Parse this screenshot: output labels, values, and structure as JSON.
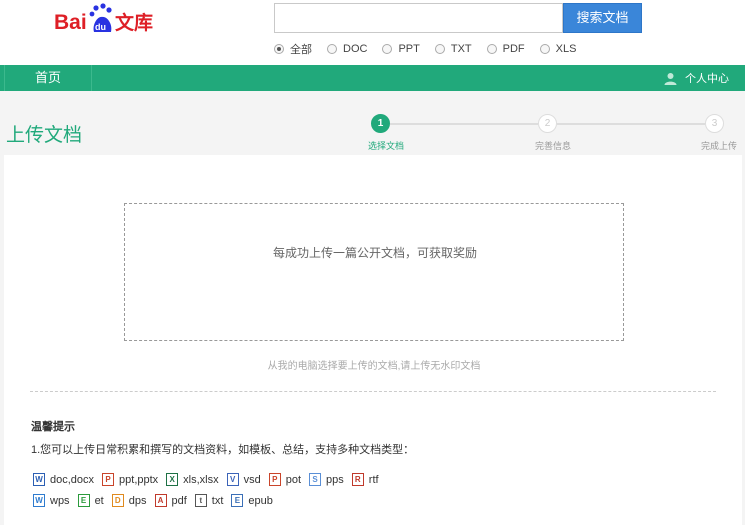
{
  "search": {
    "placeholder": "",
    "button": "搜索文档"
  },
  "filters": [
    {
      "label": "全部",
      "checked": true
    },
    {
      "label": "DOC",
      "checked": false
    },
    {
      "label": "PPT",
      "checked": false
    },
    {
      "label": "TXT",
      "checked": false
    },
    {
      "label": "PDF",
      "checked": false
    },
    {
      "label": "XLS",
      "checked": false
    }
  ],
  "nav": {
    "home": "首页",
    "user_center": "个人中心"
  },
  "page": {
    "title": "上传文档"
  },
  "steps": [
    {
      "number": "1",
      "label": "选择文档",
      "active": true
    },
    {
      "number": "2",
      "label": "完善信息",
      "active": false
    },
    {
      "number": "3",
      "label": "完成上传",
      "active": false
    }
  ],
  "upload": {
    "prompt": "每成功上传一篇公开文档，可获取奖励",
    "hint": "从我的电脑选择要上传的文档,请上传无水印文档"
  },
  "tips": {
    "title": "温馨提示",
    "desc": "1.您可以上传日常积累和撰写的文档资料，如模板、总结，支持多种文档类型："
  },
  "filetypes_row1": [
    {
      "label": "doc,docx",
      "icon": "word-icon",
      "glyph": "W",
      "color": "#2b5fb4"
    },
    {
      "label": "ppt,pptx",
      "icon": "powerpoint-icon",
      "glyph": "P",
      "color": "#c9442a"
    },
    {
      "label": "xls,xlsx",
      "icon": "excel-icon",
      "glyph": "X",
      "color": "#1e7145"
    },
    {
      "label": "vsd",
      "icon": "visio-icon",
      "glyph": "V",
      "color": "#3b63b8"
    },
    {
      "label": "pot",
      "icon": "template-icon",
      "glyph": "P",
      "color": "#c9442a"
    },
    {
      "label": "pps",
      "icon": "slideshow-icon",
      "glyph": "S",
      "color": "#5a8fd6"
    },
    {
      "label": "rtf",
      "icon": "rtf-icon",
      "glyph": "R",
      "color": "#c0392b"
    }
  ],
  "filetypes_row2": [
    {
      "label": "wps",
      "icon": "wps-icon",
      "glyph": "W",
      "color": "#2e7bcf"
    },
    {
      "label": "et",
      "icon": "et-icon",
      "glyph": "E",
      "color": "#2b9a3c"
    },
    {
      "label": "dps",
      "icon": "dps-icon",
      "glyph": "D",
      "color": "#e08a1e"
    },
    {
      "label": "pdf",
      "icon": "pdf-icon",
      "glyph": "A",
      "color": "#c0392b"
    },
    {
      "label": "txt",
      "icon": "txt-icon",
      "glyph": "t",
      "color": "#555555"
    },
    {
      "label": "epub",
      "icon": "epub-icon",
      "glyph": "E",
      "color": "#3a6fb7"
    }
  ],
  "colors": {
    "accent": "#21a97b",
    "search_button": "#3a86d9",
    "logo_red": "#de1f26",
    "logo_blue": "#2932e1"
  }
}
